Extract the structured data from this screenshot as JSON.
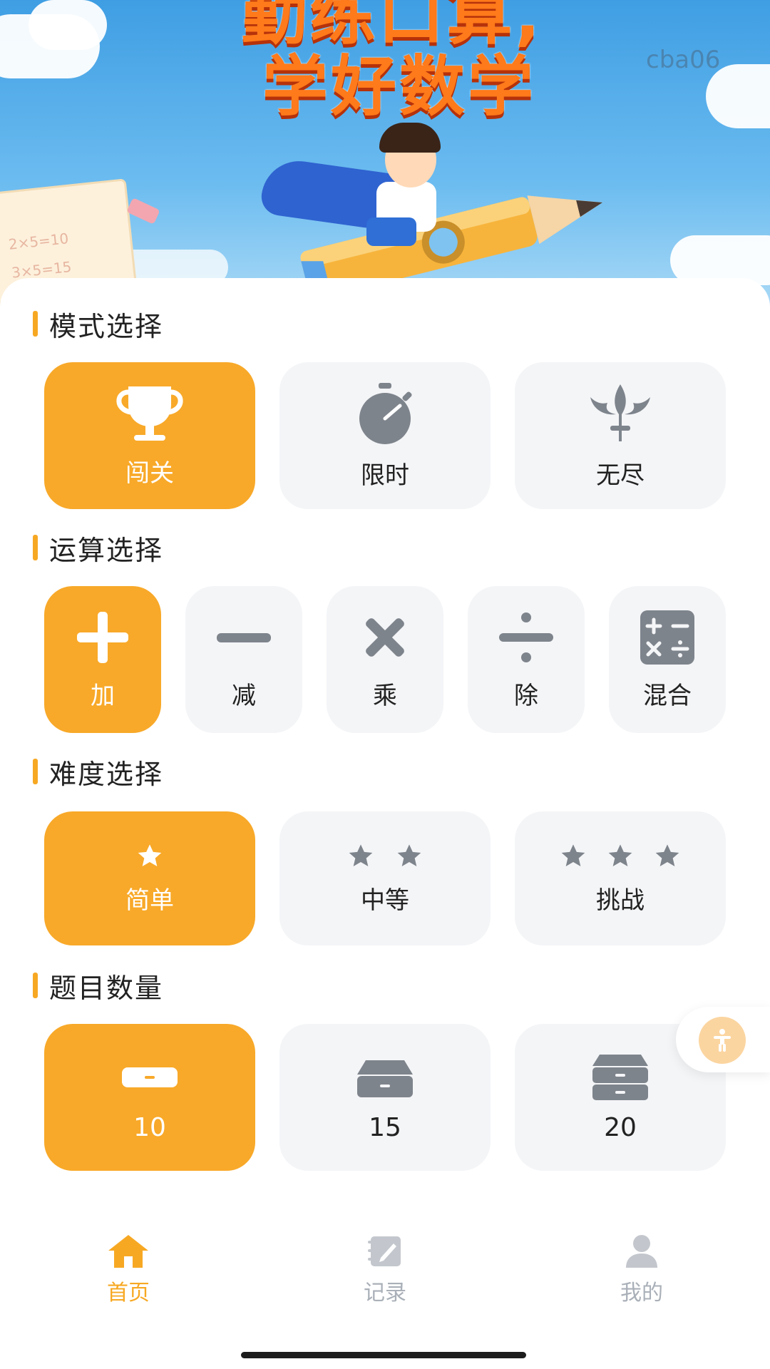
{
  "hero": {
    "title_line1": "勤练口算,",
    "title_line2": "学好数学",
    "watermark": "cba06",
    "book_line1": "2×5=10",
    "book_line2": "3×5=15"
  },
  "sections": {
    "mode": {
      "title": "模式选择",
      "options": [
        {
          "label": "闯关",
          "icon": "trophy-icon",
          "selected": true
        },
        {
          "label": "限时",
          "icon": "stopwatch-icon",
          "selected": false
        },
        {
          "label": "无尽",
          "icon": "trident-icon",
          "selected": false
        }
      ]
    },
    "operation": {
      "title": "运算选择",
      "options": [
        {
          "label": "加",
          "icon": "plus-icon",
          "selected": true
        },
        {
          "label": "减",
          "icon": "minus-icon",
          "selected": false
        },
        {
          "label": "乘",
          "icon": "multiply-icon",
          "selected": false
        },
        {
          "label": "除",
          "icon": "divide-icon",
          "selected": false
        },
        {
          "label": "混合",
          "icon": "calculator-icon",
          "selected": false
        }
      ]
    },
    "difficulty": {
      "title": "难度选择",
      "options": [
        {
          "label": "简单",
          "stars": 1,
          "selected": true
        },
        {
          "label": "中等",
          "stars": 2,
          "selected": false
        },
        {
          "label": "挑战",
          "stars": 3,
          "selected": false
        }
      ]
    },
    "count": {
      "title": "题目数量",
      "options": [
        {
          "label": "10",
          "icon": "single-tray-icon",
          "selected": true
        },
        {
          "label": "15",
          "icon": "double-tray-icon",
          "selected": false
        },
        {
          "label": "20",
          "icon": "drawer-stack-icon",
          "selected": false
        }
      ]
    }
  },
  "tabbar": {
    "tabs": [
      {
        "label": "首页",
        "icon": "home-icon",
        "active": true
      },
      {
        "label": "记录",
        "icon": "notebook-pen-icon",
        "active": false
      },
      {
        "label": "我的",
        "icon": "user-icon",
        "active": false
      }
    ]
  },
  "float_button": {
    "icon": "accessibility-icon"
  },
  "colors": {
    "accent": "#f8a929",
    "tile_bg": "#f4f5f7",
    "icon_gray": "#7e848c",
    "tab_inactive": "#aab0b8"
  }
}
